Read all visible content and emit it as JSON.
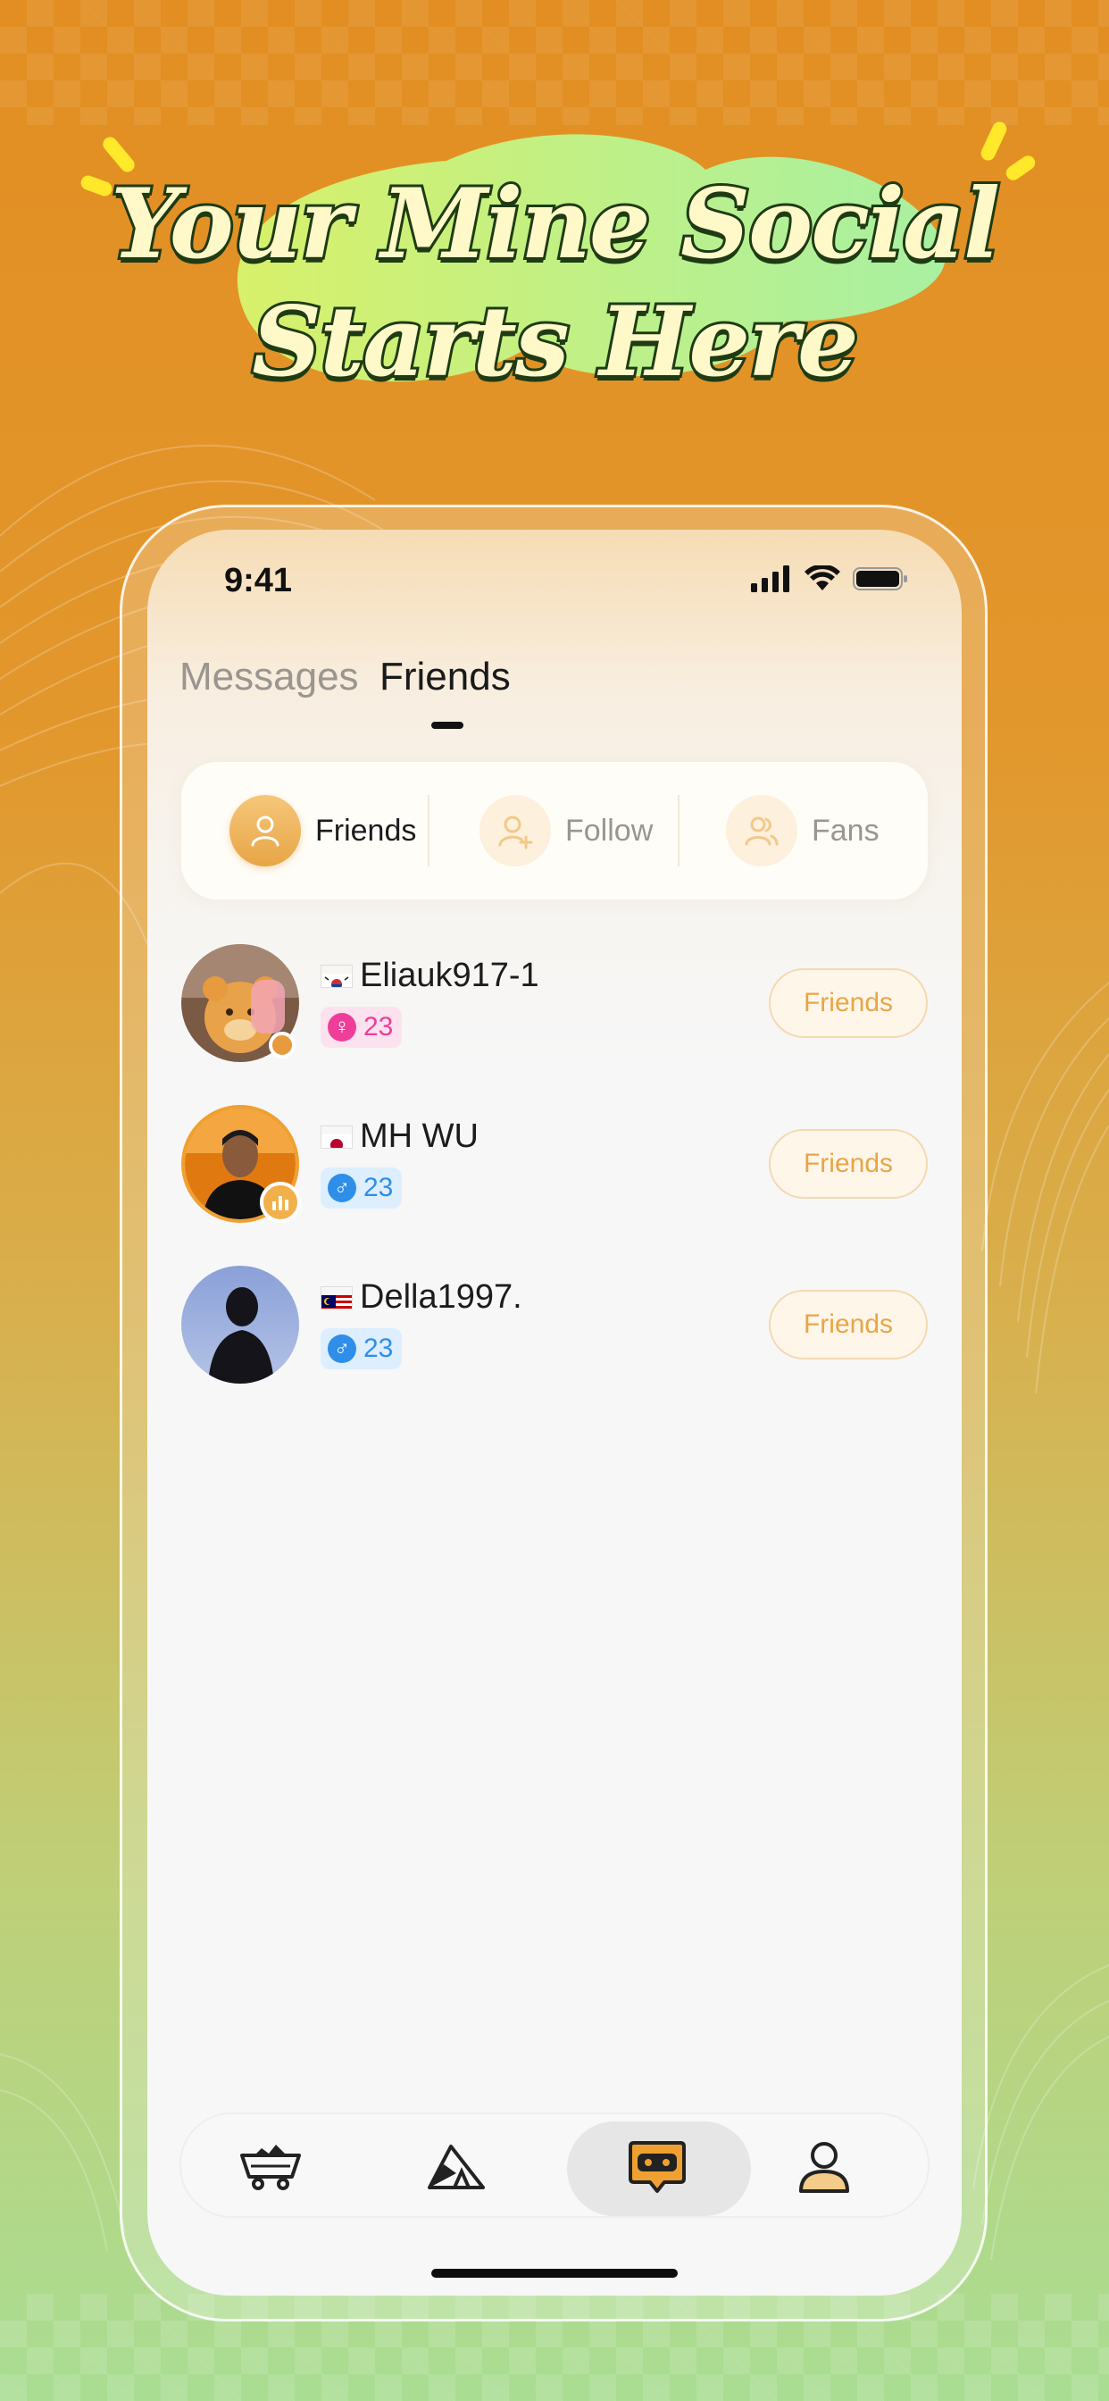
{
  "headline": {
    "line1": "Your Mine Social",
    "line2": "Starts Here"
  },
  "status_bar": {
    "time": "9:41"
  },
  "header": {
    "tabs": [
      {
        "label": "Messages",
        "active": false
      },
      {
        "label": "Friends",
        "active": true
      }
    ]
  },
  "segments": [
    {
      "label": "Friends",
      "icon": "person-icon",
      "active": true
    },
    {
      "label": "Follow",
      "icon": "person-add-icon",
      "active": false
    },
    {
      "label": "Fans",
      "icon": "people-icon",
      "active": false
    }
  ],
  "friends": [
    {
      "flag": "kr-flag-icon",
      "name": "Eliauk917-1",
      "gender": "♀",
      "age": "23",
      "button": "Friends",
      "status": "online-dot"
    },
    {
      "flag": "jp-flag-icon",
      "name": "MH WU",
      "gender": "♂",
      "age": "23",
      "button": "Friends",
      "status": "live-icon"
    },
    {
      "flag": "my-flag-icon",
      "name": "Della1997.",
      "gender": "♂",
      "age": "23",
      "button": "Friends",
      "status": ""
    }
  ],
  "bottom_nav": [
    {
      "icon": "minecart-icon",
      "active": false
    },
    {
      "icon": "tent-icon",
      "active": false
    },
    {
      "icon": "chat-face-icon",
      "active": true
    },
    {
      "icon": "profile-icon",
      "active": false
    }
  ],
  "colors": {
    "accent": "#e8a546",
    "female": "#ee3e9a",
    "male": "#2f8ee8",
    "background_top": "#e28e22",
    "background_bottom": "#a9dd93"
  }
}
